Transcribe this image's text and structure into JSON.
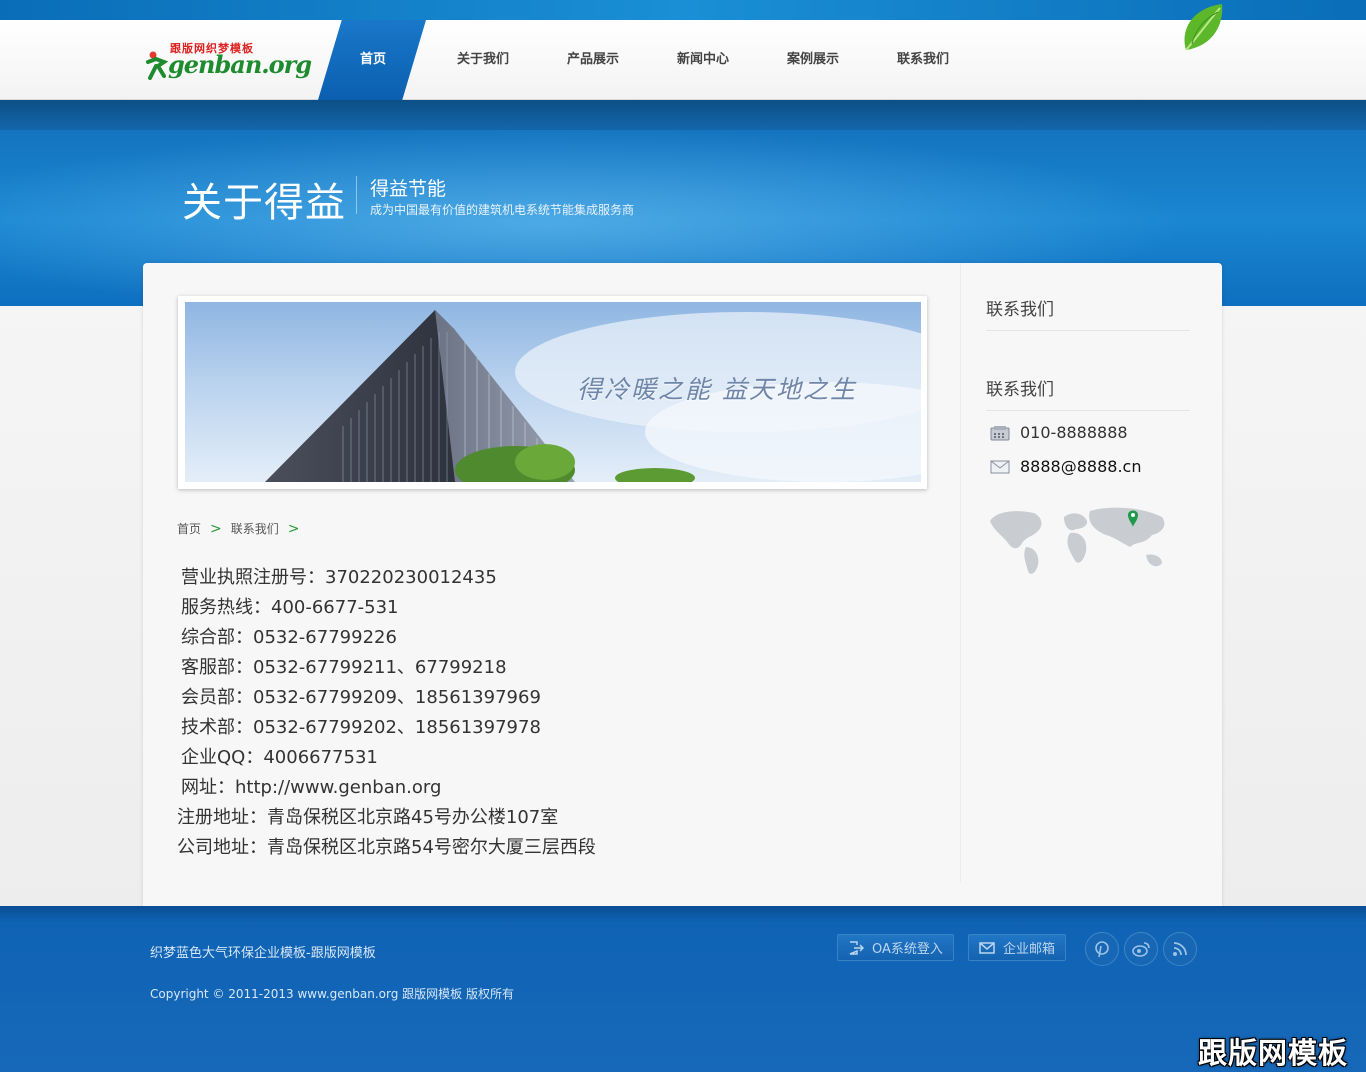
{
  "header": {
    "logo_cn": "跟版网织梦模板",
    "logo_en": "genban.org",
    "nav": [
      {
        "label": "首页",
        "active": true
      },
      {
        "label": "关于我们",
        "active": false
      },
      {
        "label": "产品展示",
        "active": false
      },
      {
        "label": "新闻中心",
        "active": false
      },
      {
        "label": "案例展示",
        "active": false
      },
      {
        "label": "联系我们",
        "active": false
      }
    ]
  },
  "banner": {
    "title": "关于得益",
    "subtitle": "得益节能",
    "tagline": "成为中国最有价值的建筑机电系统节能集成服务商"
  },
  "main": {
    "photo_slogan": "得冷暖之能  益天地之生",
    "breadcrumb": [
      "首页",
      "联系我们"
    ],
    "breadcrumb_sep": ">",
    "info": [
      "营业执照注册号：370220230012435",
      "服务热线：400-6677-531",
      "综合部：0532-67799226",
      "客服部：0532-67799211、67799218",
      "会员部：0532-67799209、18561397969",
      "技术部：0532-67799202、18561397978",
      "企业QQ：4006677531",
      "网址：http://www.genban.org"
    ],
    "addresses": [
      "注册地址：青岛保税区北京路45号办公楼107室",
      "公司地址：青岛保税区北京路54号密尔大厦三层西段"
    ]
  },
  "sidebar": {
    "section1_title": "联系我们",
    "section2_title": "联系我们",
    "phone": "010-8888888",
    "email": "8888@8888.cn"
  },
  "footer": {
    "site_name": "织梦蓝色大气环保企业模板-跟版网模板",
    "copyright": "Copyright © 2011-2013 www.genban.org 跟版网模板 版权所有",
    "oa_button": "OA系统登入",
    "mail_button": "企业邮箱"
  },
  "watermark": "跟版网模板",
  "colors": {
    "brand_blue": "#0b5fb0",
    "footer_blue": "#1768b8",
    "accent_green": "#2a9a3a"
  }
}
